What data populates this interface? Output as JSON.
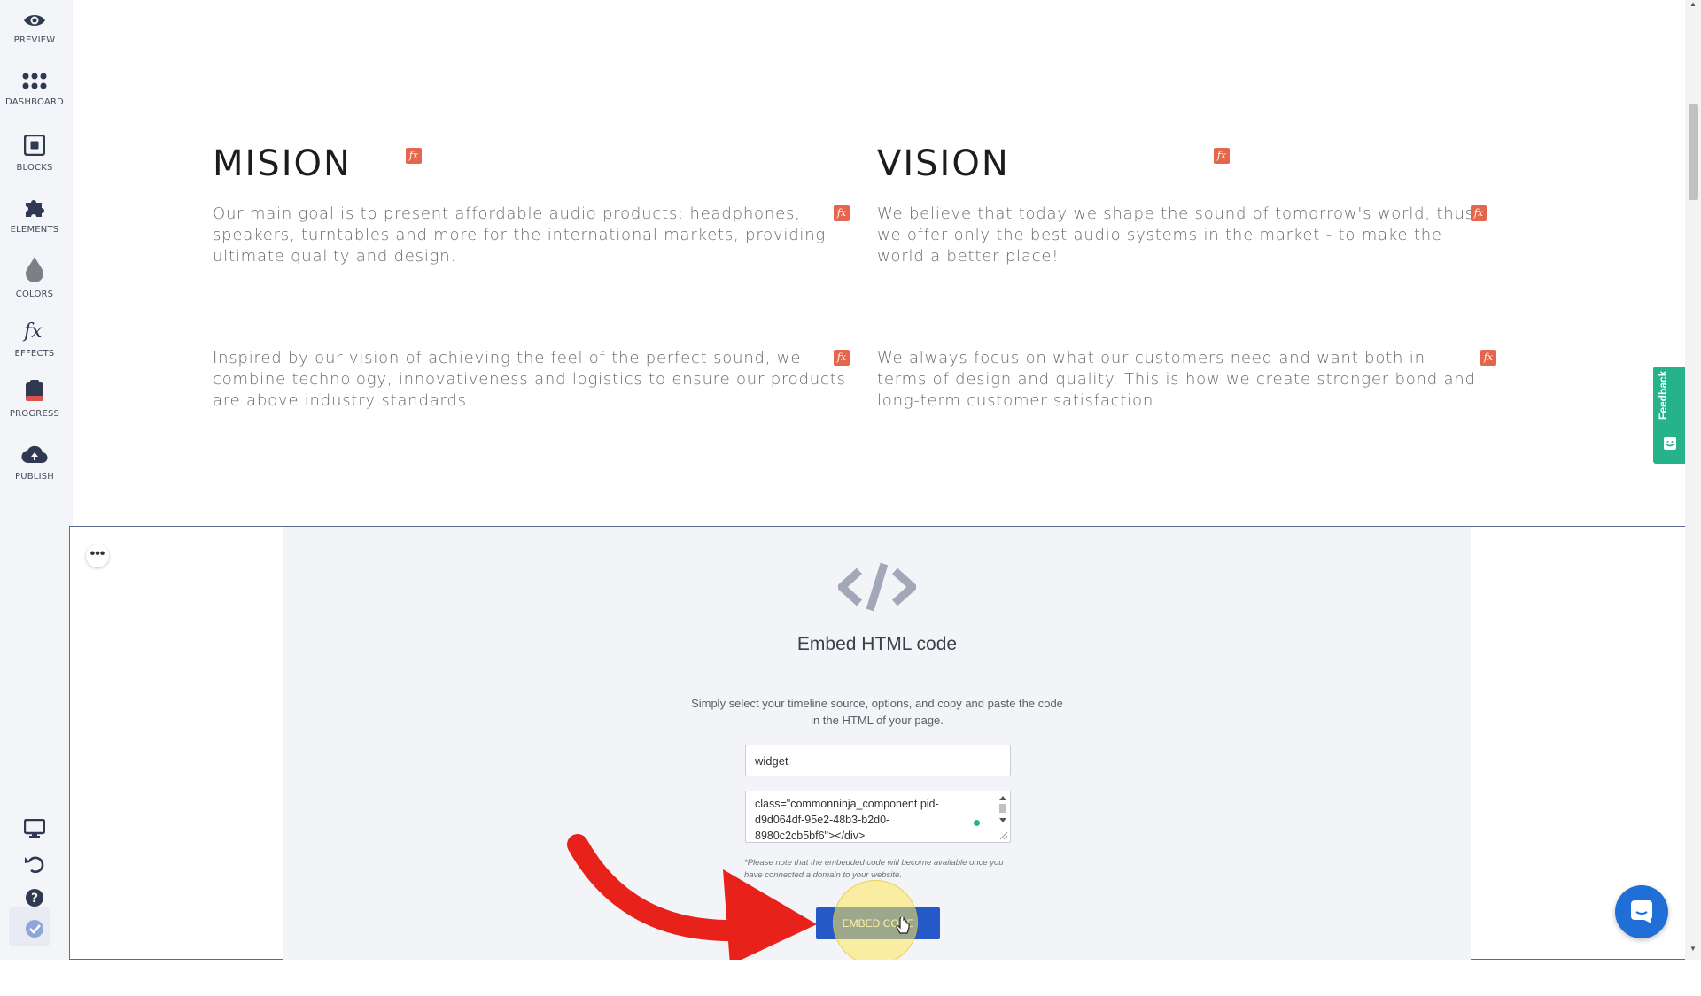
{
  "sidebar": {
    "items": [
      {
        "label": "PREVIEW",
        "icon": "eye-icon"
      },
      {
        "label": "DASHBOARD",
        "icon": "grid-dots-icon"
      },
      {
        "label": "BLOCKS",
        "icon": "blocks-icon"
      },
      {
        "label": "ELEMENTS",
        "icon": "puzzle-icon"
      },
      {
        "label": "COLORS",
        "icon": "drop-icon"
      },
      {
        "label": "EFFECTS",
        "icon": "fx-icon"
      },
      {
        "label": "PROGRESS",
        "icon": "clipboard-icon"
      },
      {
        "label": "PUBLISH",
        "icon": "cloud-upload-icon"
      }
    ],
    "bottom_icons": [
      "monitor-icon",
      "undo-icon",
      "help-icon",
      "check-badge-icon"
    ]
  },
  "content": {
    "mission_title": "MISION",
    "vision_title": "VISION",
    "mission_p1": "Our main goal is to present affordable audio products: headphones, speakers, turntables and more for the international markets, providing ultimate quality and design.",
    "mission_p2": "Inspired by our vision of achieving the feel of the perfect sound, we combine technology, innovativeness and logistics to ensure our products are above industry standards.",
    "vision_p1": "We believe that today we shape the sound of tomorrow's world, thus we offer only the best audio systems in the market - to make the world a better place!",
    "vision_p2": "We always focus on what our customers need and want both in terms of design and quality. This is how we create stronger bond and long-term customer satisfaction.",
    "fx_label": "fx"
  },
  "feedback": {
    "label": "Feedback"
  },
  "embed": {
    "more_label": "•••",
    "title": "Embed HTML code",
    "description": "Simply select your timeline source, options, and copy and paste the code in the HTML of your page.",
    "input_value": "widget",
    "code_value": "class=\"commonninja_component pid-d9d064df-95e2-48b3-b2d0-8980c2cb5bf6\"></div>",
    "note": "*Please note that the embedded code will become available once you have connected a domain to your website.",
    "button_label": "EMBED CODE"
  },
  "colors": {
    "accent_blue": "#2559c7",
    "fx_red": "#e4664c",
    "feedback_green": "#26b38a",
    "arrow_red": "#e8211b",
    "chat_blue": "#1f6fd6"
  }
}
